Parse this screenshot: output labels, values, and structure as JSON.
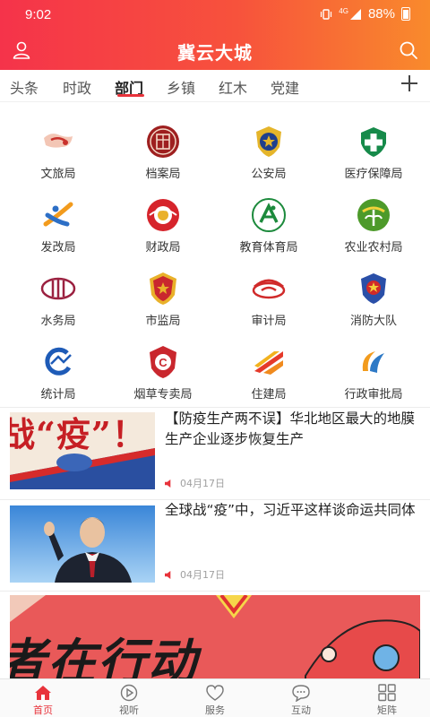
{
  "status_bar": {
    "time": "9:02",
    "network": "4G",
    "battery": "88%"
  },
  "header": {
    "title": "冀云大城"
  },
  "tabs": [
    {
      "label": "头条",
      "active": false
    },
    {
      "label": "时政",
      "active": false
    },
    {
      "label": "部门",
      "active": true
    },
    {
      "label": "乡镇",
      "active": false
    },
    {
      "label": "红木",
      "active": false
    },
    {
      "label": "党建",
      "active": false
    }
  ],
  "departments": [
    {
      "label": "文旅局",
      "icon": "culture-tourism-logo"
    },
    {
      "label": "档案局",
      "icon": "archives-seal-logo"
    },
    {
      "label": "公安局",
      "icon": "police-emblem"
    },
    {
      "label": "医疗保障局",
      "icon": "medical-security-logo"
    },
    {
      "label": "发改局",
      "icon": "development-reform-logo"
    },
    {
      "label": "财政局",
      "icon": "finance-logo"
    },
    {
      "label": "教育体育局",
      "icon": "education-sports-logo"
    },
    {
      "label": "农业农村局",
      "icon": "agriculture-logo"
    },
    {
      "label": "水务局",
      "icon": "water-affairs-logo"
    },
    {
      "label": "市监局",
      "icon": "market-supervision-emblem"
    },
    {
      "label": "审计局",
      "icon": "audit-logo"
    },
    {
      "label": "消防大队",
      "icon": "fire-brigade-emblem"
    },
    {
      "label": "统计局",
      "icon": "statistics-logo"
    },
    {
      "label": "烟草专卖局",
      "icon": "tobacco-monopoly-logo"
    },
    {
      "label": "住建局",
      "icon": "housing-construction-logo"
    },
    {
      "label": "行政审批局",
      "icon": "administrative-approval-logo"
    }
  ],
  "news": [
    {
      "title": "【防疫生产两不误】华北地区最大的地膜生产企业逐步恢复生产",
      "date": "04月17日",
      "thumb_text": "战“疫”！"
    },
    {
      "title": "全球战“疫”中，习近平这样谈命运共同体",
      "date": "04月17日"
    }
  ],
  "banner": {
    "text": "者在行动"
  },
  "bottom_nav": [
    {
      "label": "首页",
      "icon": "home-icon",
      "active": true
    },
    {
      "label": "视听",
      "icon": "play-icon",
      "active": false
    },
    {
      "label": "服务",
      "icon": "heart-icon",
      "active": false
    },
    {
      "label": "互动",
      "icon": "chat-icon",
      "active": false
    },
    {
      "label": "矩阵",
      "icon": "grid-icon",
      "active": false
    }
  ],
  "colors": {
    "accent": "#e8333b",
    "header_start": "#f5334a",
    "header_end": "#f98a2c"
  }
}
